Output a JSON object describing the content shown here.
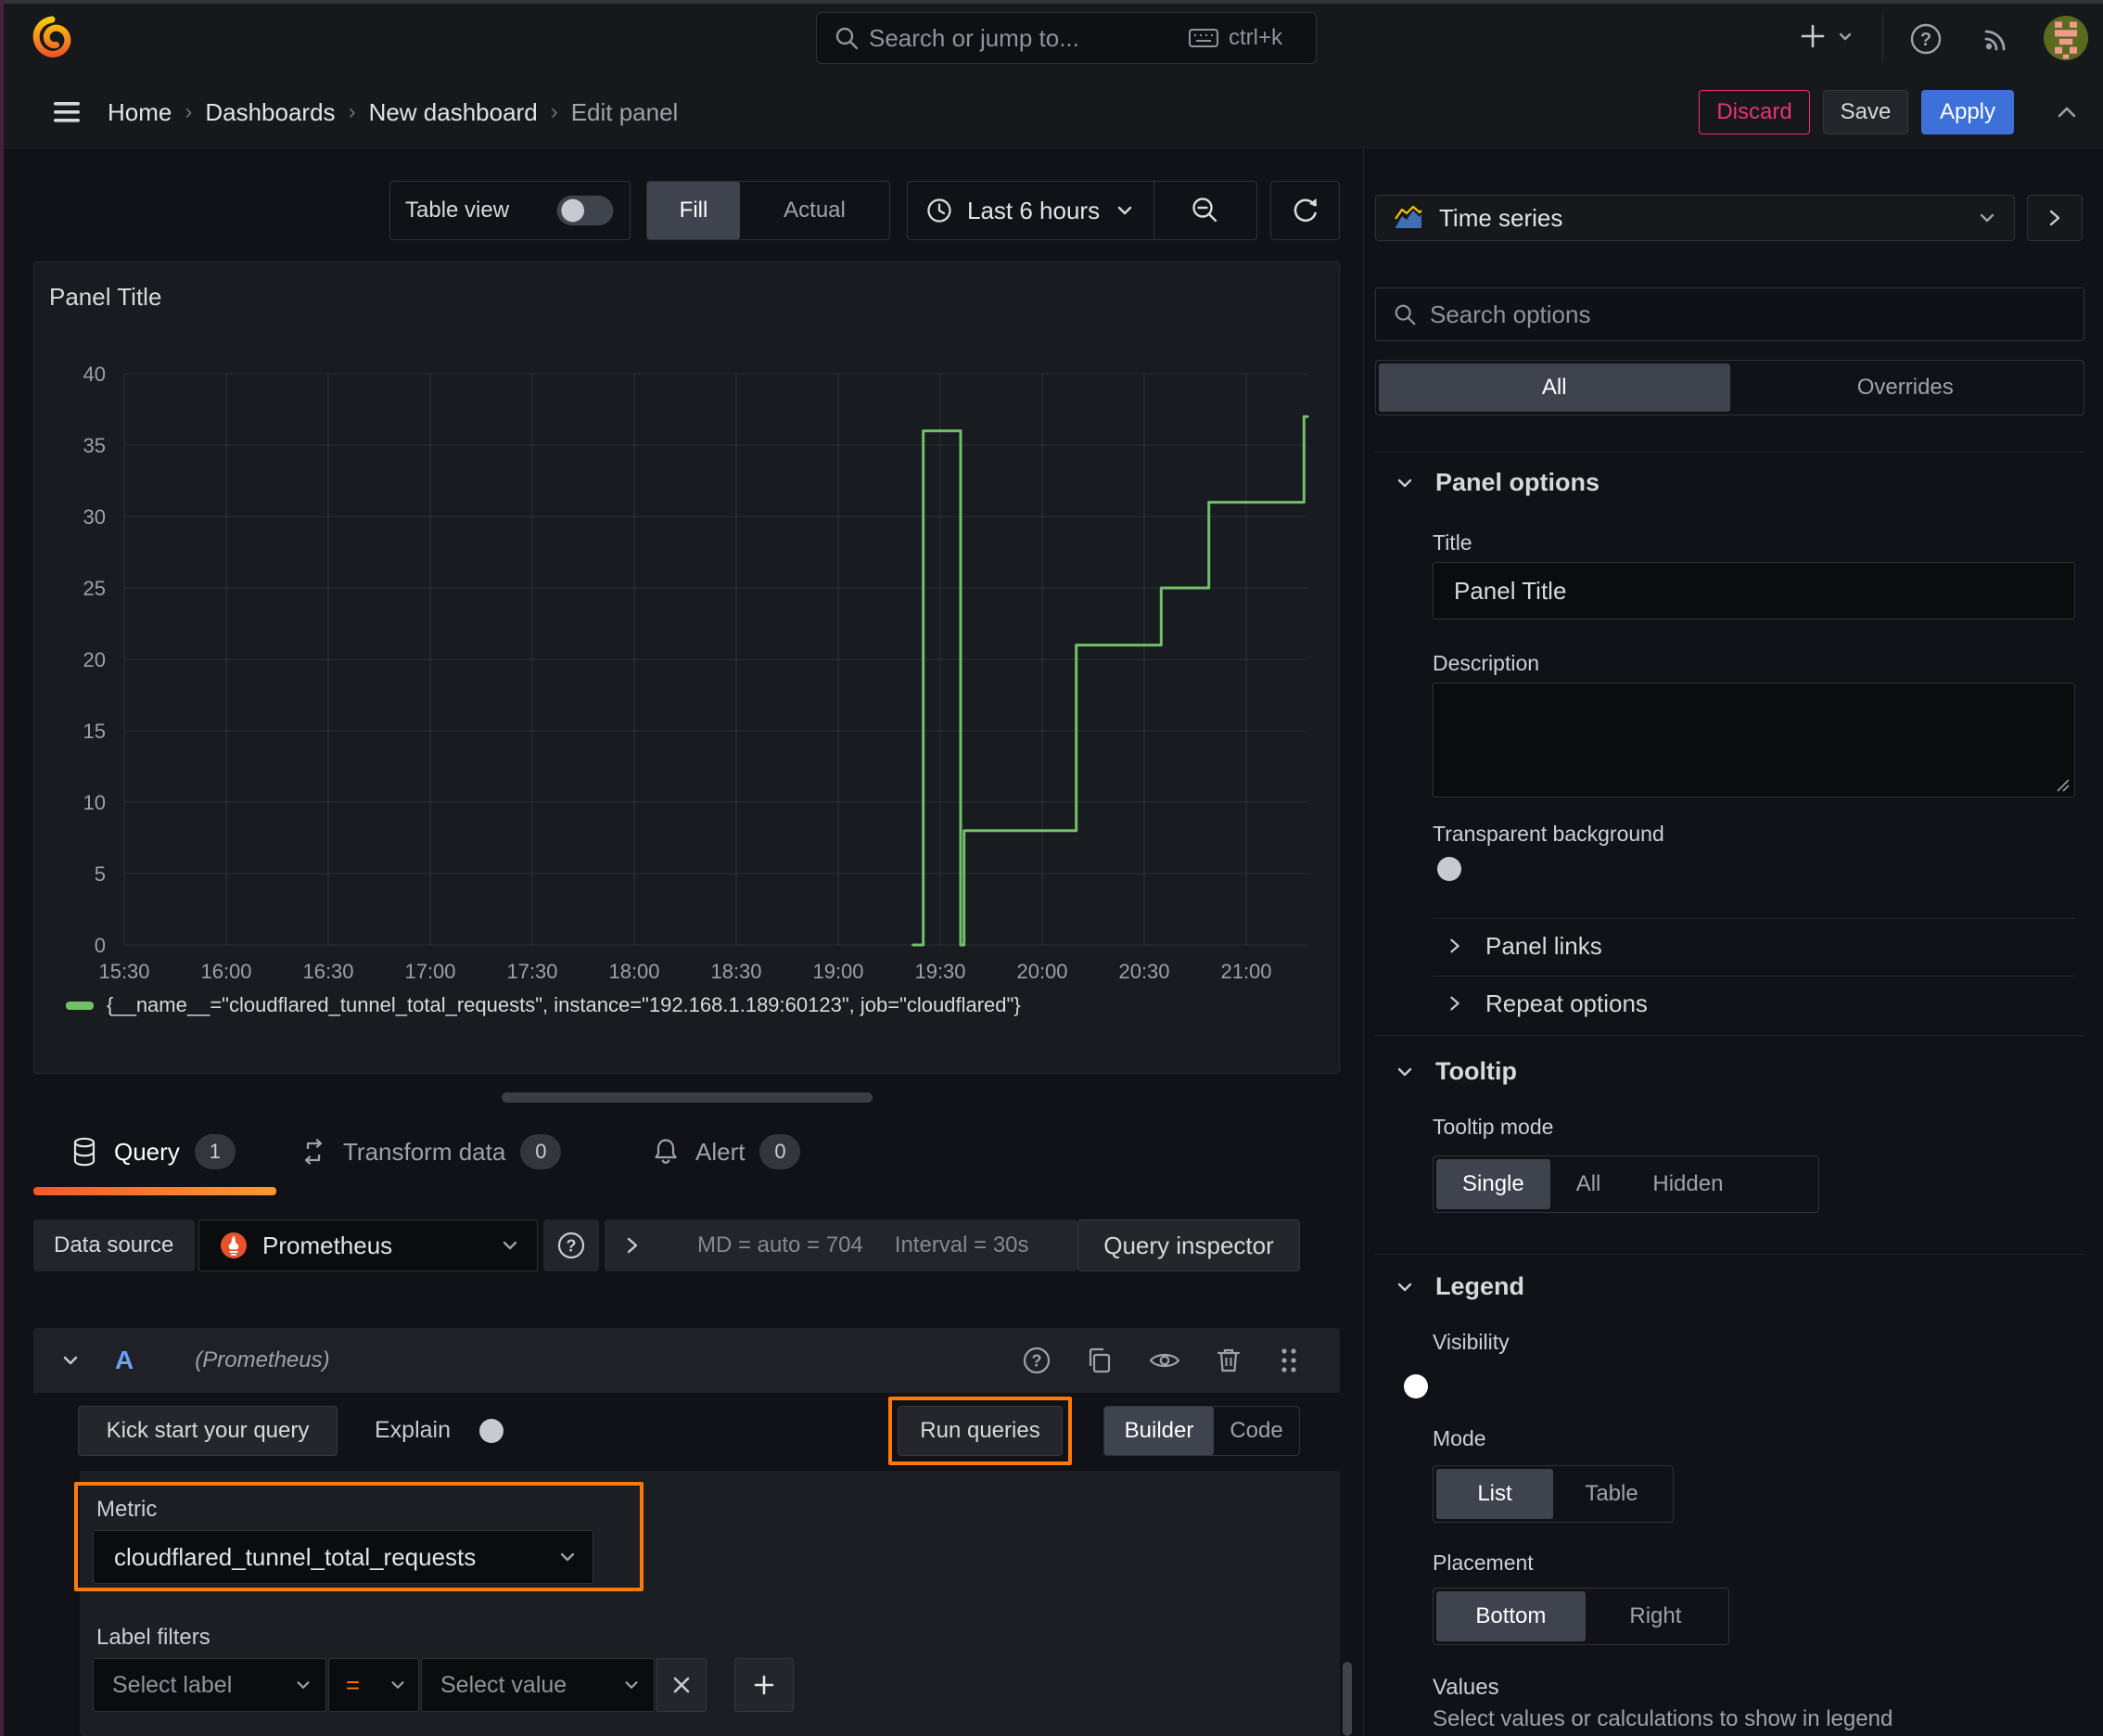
{
  "topbar": {
    "search_placeholder": "Search or jump to...",
    "shortcut": "ctrl+k"
  },
  "breadcrumb": {
    "items": [
      "Home",
      "Dashboards",
      "New dashboard",
      "Edit panel"
    ]
  },
  "actions": {
    "discard": "Discard",
    "save": "Save",
    "apply": "Apply"
  },
  "toolbar": {
    "table_view": "Table view",
    "fill": "Fill",
    "actual": "Actual",
    "time_range": "Last 6 hours"
  },
  "panel": {
    "title": "Panel Title"
  },
  "chart_data": {
    "type": "line",
    "line_style": "step-after",
    "title": "Panel Title",
    "x_ticks": [
      "15:30",
      "16:00",
      "16:30",
      "17:00",
      "17:30",
      "18:00",
      "18:30",
      "19:00",
      "19:30",
      "20:00",
      "20:30",
      "21:00"
    ],
    "y_ticks": [
      0,
      5,
      10,
      15,
      20,
      25,
      30,
      35,
      40
    ],
    "ylim": [
      0,
      40
    ],
    "x_range": [
      "15:24",
      "21:18"
    ],
    "grid": true,
    "legend_position": "bottom",
    "series": [
      {
        "name": "{__name__=\"cloudflared_tunnel_total_requests\", instance=\"192.168.1.189:60123\", job=\"cloudflared\"}",
        "color": "#73bf69",
        "points": [
          [
            "19:22",
            0
          ],
          [
            "19:25",
            36
          ],
          [
            "19:36",
            0
          ],
          [
            "19:37",
            8
          ],
          [
            "20:10",
            21
          ],
          [
            "20:35",
            25
          ],
          [
            "20:49",
            31
          ],
          [
            "21:17",
            37
          ]
        ],
        "end_time": "21:18"
      }
    ]
  },
  "tabs": {
    "query": "Query",
    "query_count": "1",
    "transform": "Transform data",
    "transform_count": "0",
    "alert": "Alert",
    "alert_count": "0"
  },
  "datasource": {
    "label": "Data source",
    "name": "Prometheus",
    "md_stat": "MD = auto = 704",
    "interval_stat": "Interval = 30s",
    "query_inspector": "Query inspector"
  },
  "query": {
    "ref_id": "A",
    "ds_hint": "(Prometheus)",
    "kick_start": "Kick start your query",
    "explain": "Explain",
    "run_queries": "Run queries",
    "builder": "Builder",
    "code": "Code",
    "metric_label": "Metric",
    "metric_value": "cloudflared_tunnel_total_requests",
    "label_filters": "Label filters",
    "select_label": "Select label",
    "operator": "=",
    "select_value": "Select value"
  },
  "sidebar": {
    "visualization": "Time series",
    "search_placeholder": "Search options",
    "tab_all": "All",
    "tab_overrides": "Overrides",
    "panel_options": {
      "header": "Panel options",
      "title_label": "Title",
      "title_value": "Panel Title",
      "description_label": "Description",
      "transparent_label": "Transparent background"
    },
    "panel_links": "Panel links",
    "repeat_options": "Repeat options",
    "tooltip": {
      "header": "Tooltip",
      "mode_label": "Tooltip mode",
      "options": [
        "Single",
        "All",
        "Hidden"
      ],
      "selected": "Single"
    },
    "legend": {
      "header": "Legend",
      "visibility_label": "Visibility",
      "mode_label": "Mode",
      "mode_options": [
        "List",
        "Table"
      ],
      "mode_selected": "List",
      "placement_label": "Placement",
      "placement_options": [
        "Bottom",
        "Right"
      ],
      "placement_selected": "Bottom",
      "values_label": "Values",
      "values_help": "Select values or calculations to show in legend"
    }
  },
  "colors": {
    "accent_blue": "#3d71d9",
    "destructive_pink": "#e8346e",
    "highlight_orange": "#ff780a",
    "series_green": "#73bf69"
  }
}
